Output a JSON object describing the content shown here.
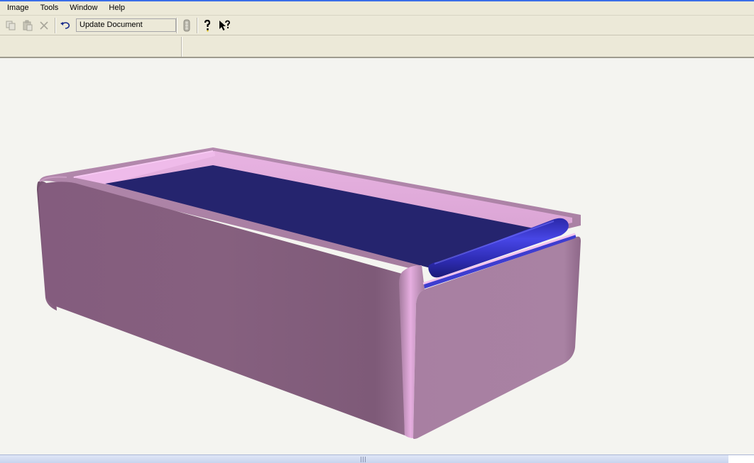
{
  "menubar": {
    "items": [
      {
        "label": "Image"
      },
      {
        "label": "Tools"
      },
      {
        "label": "Window"
      },
      {
        "label": "Help"
      }
    ]
  },
  "toolbar": {
    "icons": [
      "copy-icon",
      "paste-icon",
      "delete-icon",
      "undo-icon",
      "traffic-light-icon",
      "help-icon",
      "context-help-icon"
    ],
    "update_field_value": "Update Document"
  },
  "viewport": {
    "model": "rounded-rectangular-tray",
    "colors": {
      "tray": "#a87fa2",
      "tray_light": "#e2a9dc",
      "insert": "#25246e",
      "insert_edge": "#3e3dd0",
      "background": "#f4f4f0"
    }
  }
}
